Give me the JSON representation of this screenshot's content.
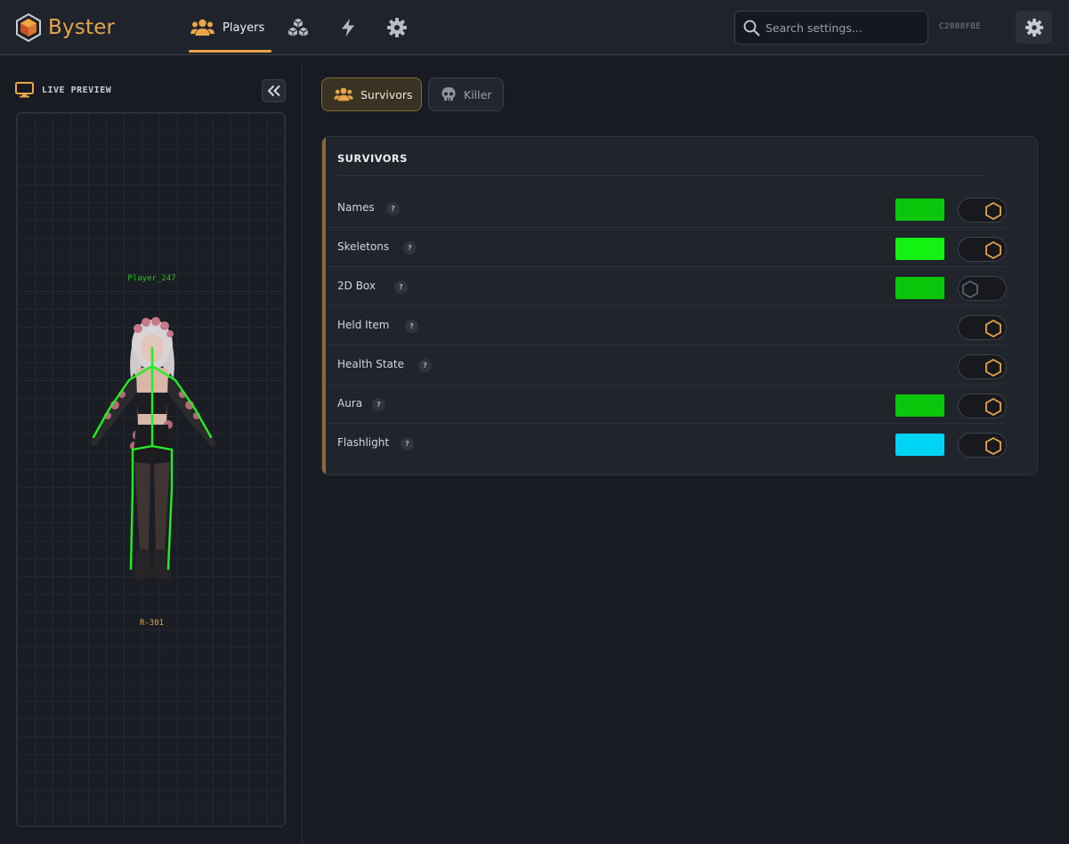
{
  "app": {
    "name": "Byster",
    "hwid": "C2088FBE"
  },
  "nav": {
    "tabs": [
      {
        "label": "Players",
        "icon": "users-icon",
        "active": true
      },
      {
        "label": "",
        "icon": "boxes-icon",
        "active": false
      },
      {
        "label": "",
        "icon": "lightning-icon",
        "active": false
      },
      {
        "label": "",
        "icon": "gear-icon",
        "active": false
      }
    ]
  },
  "search": {
    "placeholder": "Search settings..."
  },
  "preview": {
    "title": "LIVE PREVIEW",
    "player_name": "Player_247",
    "distance": "R-301"
  },
  "subtabs": [
    {
      "label": "Survivors",
      "icon": "users-icon",
      "active": true
    },
    {
      "label": "Killer",
      "icon": "skull-icon",
      "active": false
    }
  ],
  "section": {
    "title": "SURVIVORS",
    "rows": [
      {
        "label": "Names",
        "help": "?",
        "color": "#0bc70b",
        "enabled": true
      },
      {
        "label": "Skeletons",
        "help": "?",
        "color": "#12f312",
        "enabled": true
      },
      {
        "label": "2D Box",
        "help": "?",
        "color": "#0bc70b",
        "enabled": false
      },
      {
        "label": "Held Item",
        "help": "?",
        "color": null,
        "enabled": true
      },
      {
        "label": "Health State",
        "help": "?",
        "color": null,
        "enabled": true
      },
      {
        "label": "Aura",
        "help": "?",
        "color": "#0bc70b",
        "enabled": true
      },
      {
        "label": "Flashlight",
        "help": "?",
        "color": "#00d4f5",
        "enabled": true
      }
    ]
  },
  "colors": {
    "accent": "#e8a54b",
    "skeleton": "#22ee22"
  }
}
